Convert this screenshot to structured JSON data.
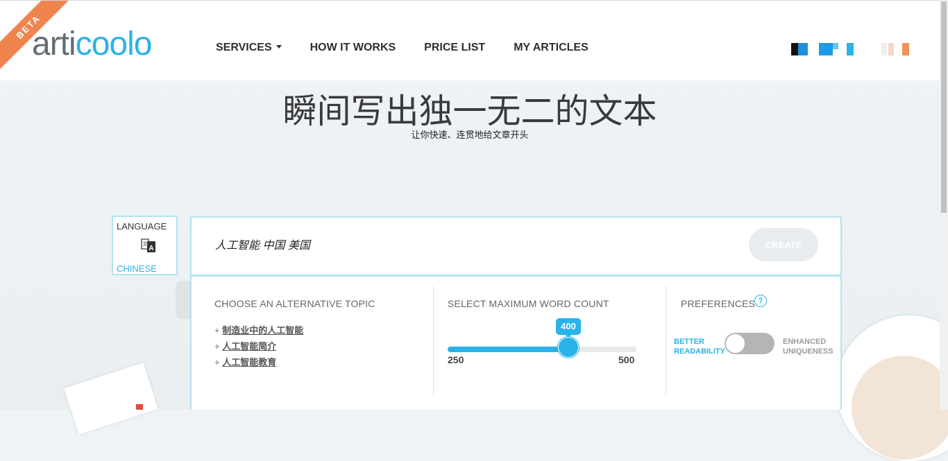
{
  "header": {
    "badge": "BETA",
    "logo": {
      "part1": "arti",
      "part2": "coolo"
    },
    "nav": [
      {
        "label": "SERVICES"
      },
      {
        "label": "HOW IT WORKS"
      },
      {
        "label": "PRICE LIST"
      },
      {
        "label": "MY ARTICLES"
      }
    ]
  },
  "hero": {
    "title": "瞬间写出独一无二的文本",
    "subtitle": "让你快速、连贯地给文章开头"
  },
  "language": {
    "label": "LANGUAGE",
    "icon": "translate-icon",
    "value": "CHINESE"
  },
  "topic": {
    "value": "人工智能 中国 美国",
    "create_label": "CREATE"
  },
  "alternatives": {
    "title": "CHOOSE AN ALTERNATIVE TOPIC",
    "items": [
      "制造业中的人工智能",
      "人工智能简介",
      "人工智能教育"
    ]
  },
  "word_count": {
    "title": "SELECT MAXIMUM WORD COUNT",
    "value": "400",
    "min": "250",
    "max": "500",
    "level": 0.6
  },
  "preferences": {
    "title": "PREFERENCES",
    "help": "?",
    "left_line1": "BETTER",
    "left_line2": "READABILITY",
    "right_line1": "ENHANCED",
    "right_line2": "UNIQUENESS",
    "state": "readability"
  },
  "colors": {
    "accent": "#29b3e9",
    "ribbon": "#f0844f",
    "border": "#b3e3f2"
  }
}
